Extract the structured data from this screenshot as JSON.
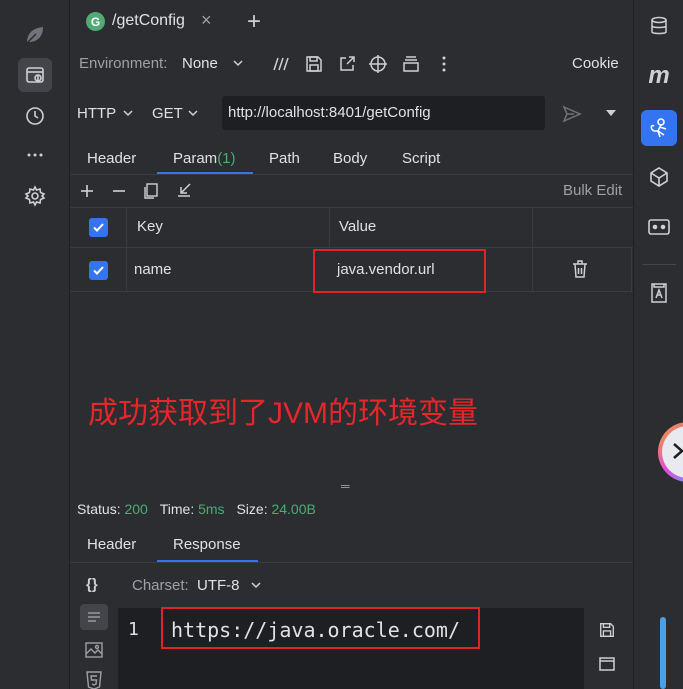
{
  "editor_tab": {
    "badge": "G",
    "title": "/getConfig",
    "close": "×",
    "add": "+"
  },
  "toolbar": {
    "env_label": "Environment:",
    "env_value": "None",
    "cookie": "Cookie"
  },
  "request": {
    "protocol": "HTTP",
    "method": "GET",
    "url": "http://localhost:8401/getConfig"
  },
  "req_tabs": {
    "header": "Header",
    "param": "Param",
    "param_count": "(1)",
    "path": "Path",
    "body": "Body",
    "script": "Script"
  },
  "params_toolbar": {
    "bulk_edit": "Bulk Edit"
  },
  "params_table": {
    "headers": {
      "key": "Key",
      "value": "Value"
    },
    "rows": [
      {
        "key": "name",
        "value": "java.vendor.url"
      }
    ]
  },
  "annotation": "成功获取到了JVM的环境变量",
  "divider_handle": "═",
  "status": {
    "status_label": "Status:",
    "status_value": "200",
    "time_label": "Time:",
    "time_value": "5ms",
    "size_label": "Size:",
    "size_value": "24.00B"
  },
  "resp_tabs": {
    "header": "Header",
    "response": "Response"
  },
  "response": {
    "format_icon": "{}",
    "charset_label": "Charset:",
    "charset_value": "UTF-8",
    "line_number": "1",
    "body": "https://java.oracle.com/"
  },
  "right_sidebar": {
    "m_label": "m"
  },
  "colors": {
    "accent": "#3574f0",
    "success": "#4faa76",
    "annotation_red": "#e5262a",
    "background": "#2b2d30",
    "editor_bg": "#1e1f22"
  }
}
